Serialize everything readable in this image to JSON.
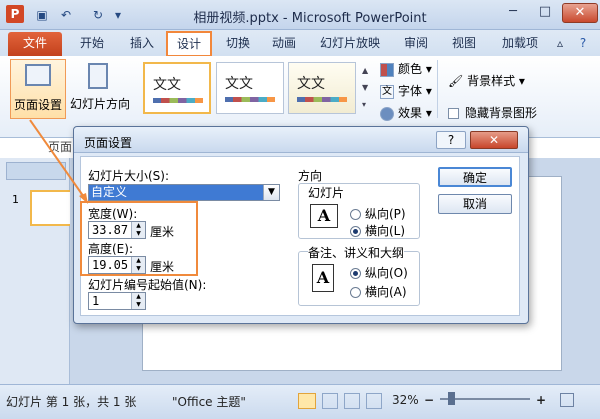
{
  "app": {
    "title": "相册视频.pptx - Microsoft PowerPoint",
    "undo_icon": "↶",
    "redo_icon": "↻",
    "minimize": "─",
    "maximize": "□",
    "close": "✕"
  },
  "tabs": [
    {
      "label": "文件"
    },
    {
      "label": "开始"
    },
    {
      "label": "插入"
    },
    {
      "label": "设计"
    },
    {
      "label": "切换"
    },
    {
      "label": "动画"
    },
    {
      "label": "幻灯片放映"
    },
    {
      "label": "审阅"
    },
    {
      "label": "视图"
    },
    {
      "label": "加载项"
    }
  ],
  "ribbon": {
    "page_setup_label": "页面设置",
    "orientation_label": "幻灯片方向",
    "theme_text": "文文",
    "colors_label": "颜色",
    "fonts_label": "字体",
    "effects_label": "效果",
    "bg_style_label": "背景样式",
    "hide_bg_label": "隐藏背景图形",
    "group_page_label": "页面"
  },
  "thumbnail": {
    "number": "1"
  },
  "status": {
    "slide_info": "幻灯片 第 1 张，共 1 张",
    "theme": "\"Office 主题\"",
    "zoom": "32%",
    "zoom_minus": "−",
    "zoom_plus": "+"
  },
  "dialog": {
    "title": "页面设置",
    "help": "?",
    "close": "✕",
    "size_label": "幻灯片大小(S):",
    "size_value": "自定义",
    "width_label": "宽度(W):",
    "width_value": "33.87",
    "height_label": "高度(E):",
    "height_value": "19.05",
    "unit": "厘米",
    "start_label": "幻灯片编号起始值(N):",
    "start_value": "1",
    "direction_label": "方向",
    "slides_group": "幻灯片",
    "notes_group": "备注、讲义和大纲",
    "portrait_p": "纵向(P)",
    "landscape_l": "横向(L)",
    "portrait_o": "纵向(O)",
    "landscape_a": "横向(A)",
    "ok": "确定",
    "cancel": "取消",
    "page_letter": "A"
  }
}
